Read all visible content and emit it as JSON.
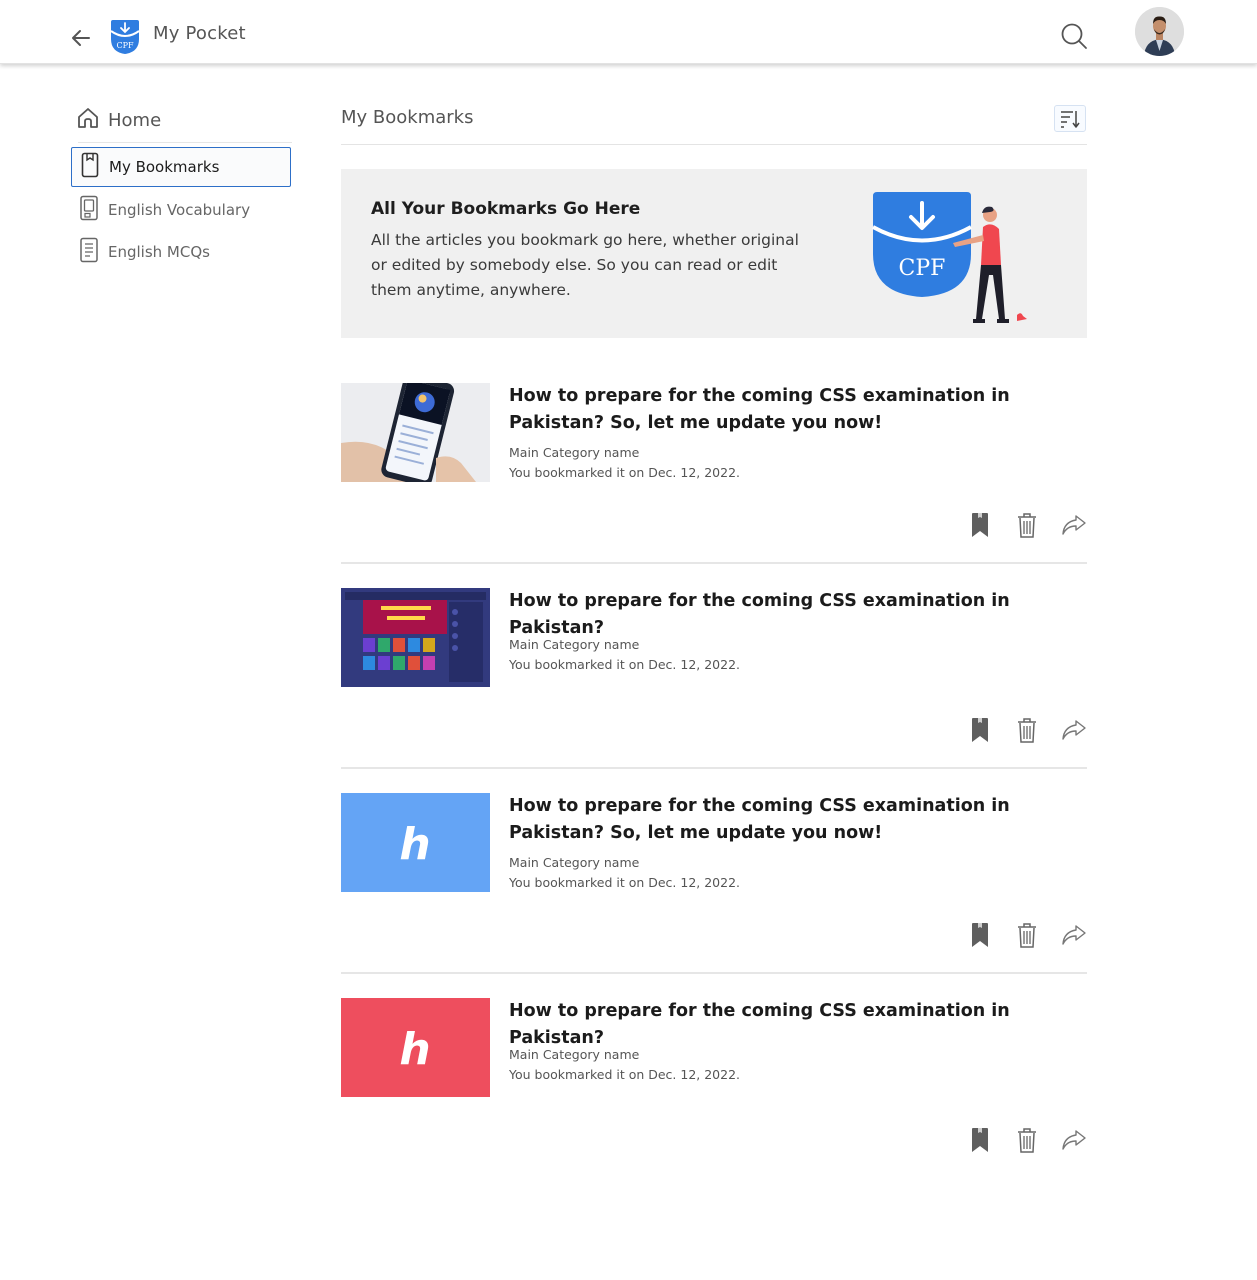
{
  "header": {
    "app_title": "My Pocket",
    "logo_text": "CPF",
    "brand_color": "#2f7de0"
  },
  "sidebar": {
    "home_label": "Home",
    "items": [
      {
        "label": "My Bookmarks",
        "icon": "bookmark-icon",
        "active": true
      },
      {
        "label": "English Vocabulary",
        "icon": "book-icon",
        "active": false
      },
      {
        "label": "English MCQs",
        "icon": "document-icon",
        "active": false
      }
    ]
  },
  "main": {
    "title": "My Bookmarks",
    "banner": {
      "title": "All Your Bookmarks Go Here",
      "text": "All the articles you bookmark go here, whether original or edited by somebody else. So you can read or edit them anytime, anywhere.",
      "logo_text": "CPF"
    },
    "cards": [
      {
        "title": "How to prepare for the coming CSS examination in Pakistan? So, let me update you now!",
        "category": "Main Category name",
        "bookmarked": "You bookmarked it on Dec. 12, 2022.",
        "thumb": "phone-photo"
      },
      {
        "title": "How to prepare for the coming CSS examination in Pakistan?",
        "category": "Main Category name",
        "bookmarked": "You bookmarked it on Dec. 12, 2022.",
        "thumb": "website-screenshot"
      },
      {
        "title": "How to prepare for the coming CSS examination in Pakistan? So, let me update you now!",
        "category": "Main Category name",
        "bookmarked": "You bookmarked it on Dec. 12, 2022.",
        "thumb": "blue-h-logo",
        "thumb_color": "#64a4f5",
        "thumb_letter": "h"
      },
      {
        "title": "How to prepare for the coming CSS examination in Pakistan?",
        "category": "Main Category name",
        "bookmarked": "You bookmarked it on Dec. 12, 2022.",
        "thumb": "red-h-logo",
        "thumb_color": "#ee4e5e",
        "thumb_letter": "h"
      }
    ]
  }
}
